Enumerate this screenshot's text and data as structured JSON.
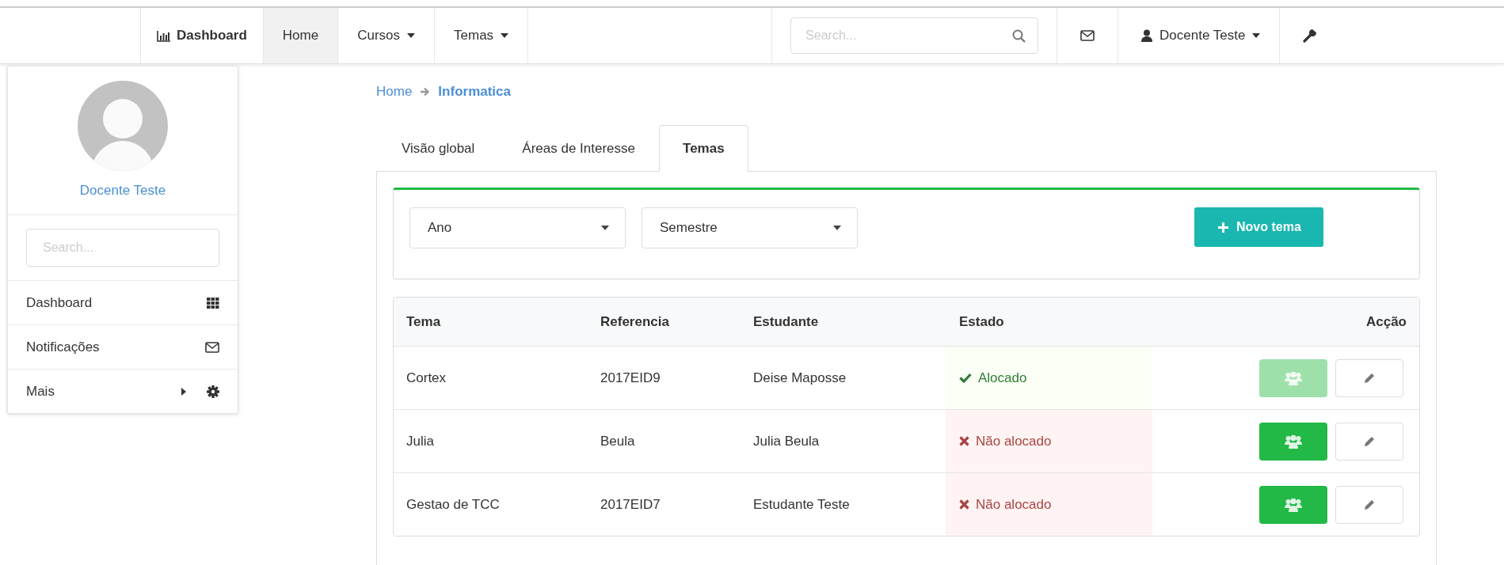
{
  "navbar": {
    "brand": "Dashboard",
    "items": [
      {
        "label": "Home",
        "selected": true,
        "dropdown": false
      },
      {
        "label": "Cursos",
        "selected": false,
        "dropdown": true
      },
      {
        "label": "Temas",
        "selected": false,
        "dropdown": true
      }
    ],
    "search": {
      "placeholder": "Search..."
    },
    "user": "Docente Teste"
  },
  "sidebar": {
    "name": "Docente Teste",
    "search": {
      "placeholder": "Search..."
    },
    "items": [
      {
        "label": "Dashboard",
        "kind": "grid"
      },
      {
        "label": "Notificações",
        "kind": "mail"
      },
      {
        "label": "Mais",
        "kind": "more"
      }
    ]
  },
  "breadcrumb": [
    "Home",
    "Informatica"
  ],
  "tabs": [
    {
      "label": "Visão global",
      "selected": false
    },
    {
      "label": "Áreas de Interesse",
      "selected": false
    },
    {
      "label": "Temas",
      "selected": true
    }
  ],
  "filters": [
    {
      "label": "Ano"
    },
    {
      "label": "Semestre"
    }
  ],
  "new_button": "Novo tema",
  "table": {
    "columns": [
      "Tema",
      "Referencia",
      "Estudante",
      "Estado",
      "Acção"
    ],
    "rows": [
      {
        "tema": "Cortex",
        "referencia": "2017EID9",
        "estudante": "Deise Maposse",
        "estado": "Alocado",
        "allocated": true,
        "assign_disabled": true
      },
      {
        "tema": "Julia",
        "referencia": "Beula",
        "estudante": "Julia Beula",
        "estado": "Não alocado",
        "allocated": false,
        "assign_disabled": false
      },
      {
        "tema": "Gestao de TCC",
        "referencia": "2017EID7",
        "estudante": "Estudante Teste",
        "estado": "Não alocado",
        "allocated": false,
        "assign_disabled": false
      }
    ]
  }
}
